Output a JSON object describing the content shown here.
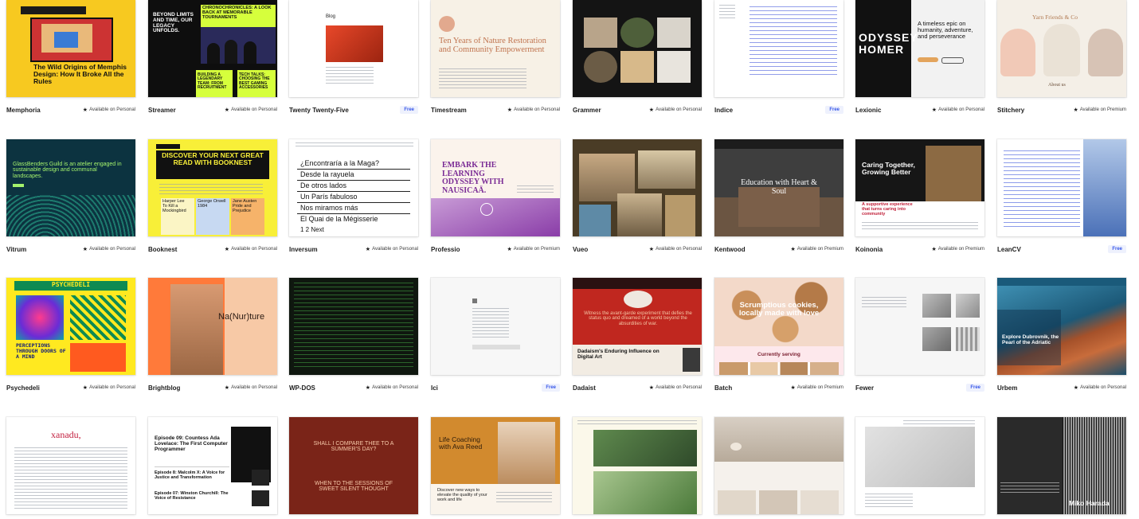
{
  "badges": {
    "personal": "Available on Personal",
    "premium": "Available on Premium",
    "free": "Free"
  },
  "star_icon": "star-icon",
  "themes": [
    {
      "id": "memphoria",
      "name": "Memphoria",
      "badge": "personal",
      "texts": [
        "The Wild Origins of Memphis Design: How It Broke All the Rules"
      ]
    },
    {
      "id": "streamer",
      "name": "Streamer",
      "badge": "personal",
      "texts": [
        "BEYOND LIMITS AND TIME, OUR LEGACY UNFOLDS.",
        "CHRONOCHRONICLES: A LOOK BACK AT MEMORABLE TOURNAMENTS",
        "BUILDING A LEGENDARY TEAM: FROM RECRUITMENT",
        "TECH TALKS: CHOOSING THE BEST GAMING ACCESSORIES"
      ]
    },
    {
      "id": "twentytwentyfive",
      "name": "Twenty Twenty-Five",
      "badge": "free",
      "texts": [
        "Blog"
      ]
    },
    {
      "id": "timestream",
      "name": "Timestream",
      "badge": "personal",
      "texts": [
        "Ten Years of Nature Restoration and Community Empowerment"
      ]
    },
    {
      "id": "grammer",
      "name": "Grammer",
      "badge": "personal",
      "texts": []
    },
    {
      "id": "indice",
      "name": "Indice",
      "badge": "free",
      "texts": []
    },
    {
      "id": "lexionic",
      "name": "Lexionic",
      "badge": "personal",
      "texts": [
        "ODYSSEY HOMER",
        "A timeless epic on humanity, adventure, and perseverance"
      ]
    },
    {
      "id": "stitchery",
      "name": "Stitchery",
      "badge": "premium",
      "texts": [
        "Yarn Friends & Co",
        "About us"
      ]
    },
    {
      "id": "vitrum",
      "name": "Vitrum",
      "badge": "personal",
      "texts": [
        "GlassBenders Guild is an atelier engaged in sustainable design and communal landscapes."
      ]
    },
    {
      "id": "booknest",
      "name": "Booknest",
      "badge": "personal",
      "texts": [
        "DISCOVER YOUR NEXT GREAT READ WITH BOOKNEST",
        "Harper Lee\nTo Kill a Mockingbird",
        "George Orwell\n1984",
        "Jane Austen\nPride and Prejudice"
      ]
    },
    {
      "id": "inversum",
      "name": "Inversum",
      "badge": "personal",
      "texts": [
        "¿Encontraría a la Maga?",
        "Desde la rayuela",
        "De otros lados",
        "Un París fabuloso",
        "Nos miramos más",
        "El Quai de la Mégisserie",
        "1 2   Next"
      ]
    },
    {
      "id": "professio",
      "name": "Professio",
      "badge": "premium",
      "texts": [
        "EMBARK THE LEARNING ODYSSEY WITH NAUSICAÄ."
      ]
    },
    {
      "id": "vueo",
      "name": "Vueo",
      "badge": "personal",
      "texts": []
    },
    {
      "id": "kentwood",
      "name": "Kentwood",
      "badge": "premium",
      "texts": [
        "Education with Heart & Soul"
      ]
    },
    {
      "id": "koinonia",
      "name": "Koinonia",
      "badge": "premium",
      "texts": [
        "Caring Together, Growing Better",
        "A supportive experience that turns caring into community"
      ]
    },
    {
      "id": "leancv",
      "name": "LeanCV",
      "badge": "free",
      "texts": []
    },
    {
      "id": "psychedeli",
      "name": "Psychedeli",
      "badge": "personal",
      "texts": [
        "PSYCHEDELI",
        "PERCEPTIONS THROUGH DOORS OF A MIND"
      ]
    },
    {
      "id": "brightblog",
      "name": "Brightblog",
      "badge": "personal",
      "texts": [
        "Na(Nur)ture"
      ]
    },
    {
      "id": "wpdos",
      "name": "WP-DOS",
      "badge": "personal",
      "texts": []
    },
    {
      "id": "ici",
      "name": "Ici",
      "badge": "free",
      "texts": []
    },
    {
      "id": "dadaist",
      "name": "Dadaist",
      "badge": "personal",
      "texts": [
        "Witness the avant-garde experiment that defies the status quo and dreamed of a world beyond the absurdities of war.",
        "Dadaism's Enduring Influence on Digital Art"
      ]
    },
    {
      "id": "batch",
      "name": "Batch",
      "badge": "premium",
      "texts": [
        "Scrumptious cookies, locally made with love",
        "Currently serving"
      ]
    },
    {
      "id": "fewer",
      "name": "Fewer",
      "badge": "free",
      "texts": []
    },
    {
      "id": "urbem",
      "name": "Urbem",
      "badge": "personal",
      "texts": [
        "Explore Dubrovnik, the Pearl of the Adriatic"
      ]
    },
    {
      "id": "xanadu",
      "name": "",
      "badge": "",
      "texts": [
        "xanadu,"
      ]
    },
    {
      "id": "podcast",
      "name": "",
      "badge": "",
      "texts": [
        "Episode 09: Countess Ada Lovelace: The First Computer Programmer",
        "Episode 8: Malcolm X: A Voice for Justice and Transformation",
        "Episode 07: Winston Churchill: The Voice of Resistance"
      ]
    },
    {
      "id": "sonnet",
      "name": "",
      "badge": "",
      "texts": [
        "SHALL I COMPARE THEE TO A SUMMER'S DAY?",
        "WHEN TO THE SESSIONS OF SWEET SILENT THOUGHT"
      ]
    },
    {
      "id": "coaching",
      "name": "",
      "badge": "",
      "texts": [
        "Life Coaching with Ava Reed",
        "Discover new ways to elevate the quality of your work and life"
      ]
    },
    {
      "id": "greenhouse",
      "name": "",
      "badge": "",
      "texts": []
    },
    {
      "id": "ceramics",
      "name": "",
      "badge": "",
      "texts": []
    },
    {
      "id": "minimal",
      "name": "",
      "badge": "",
      "texts": []
    },
    {
      "id": "mikoharada",
      "name": "",
      "badge": "",
      "texts": [
        "Miko Harada"
      ]
    }
  ]
}
